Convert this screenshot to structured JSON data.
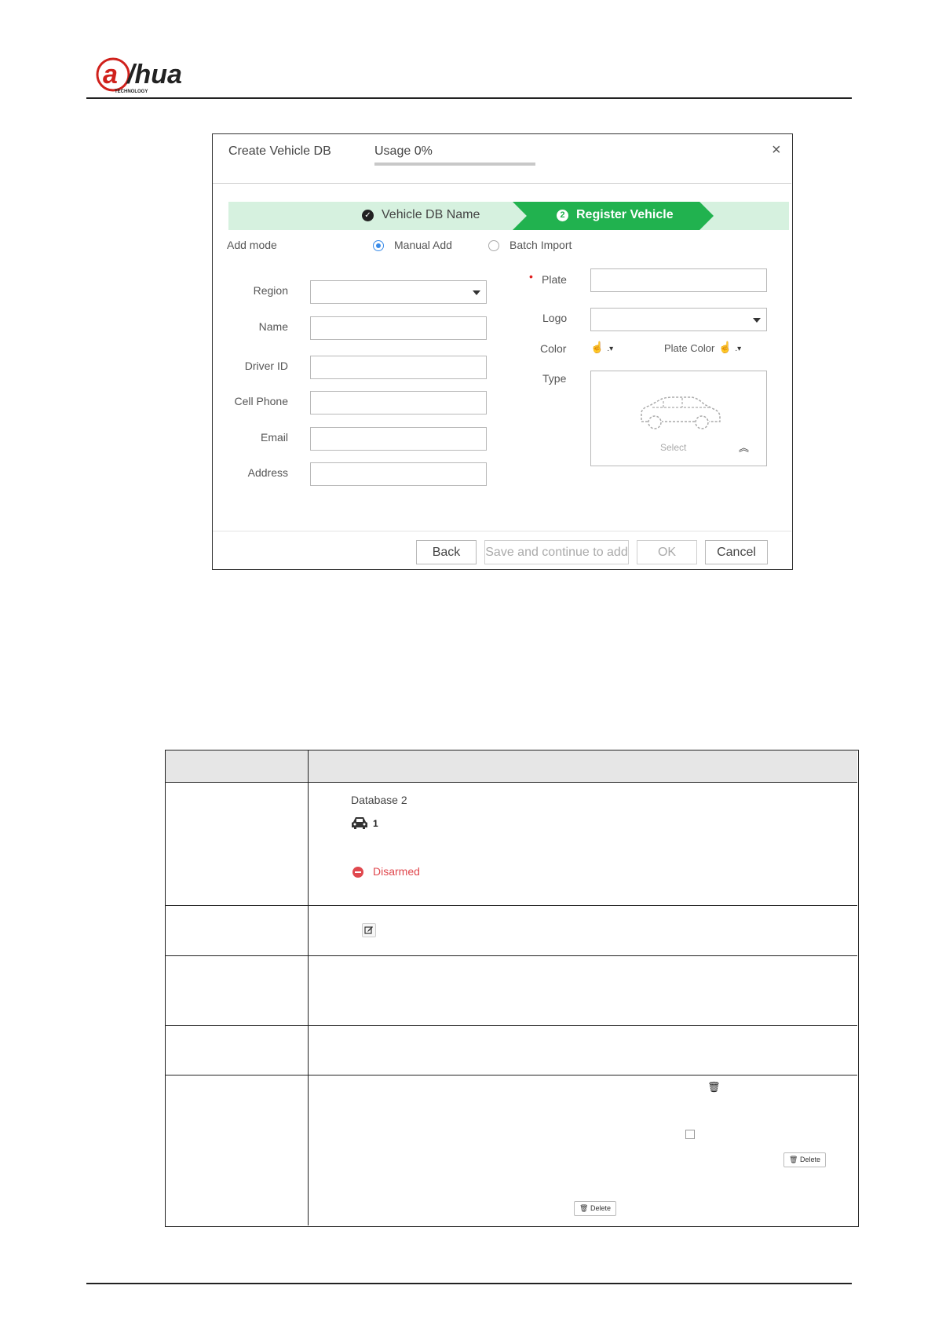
{
  "brand": {
    "logo_text": "alhua",
    "logo_sub": "TECHNOLOGY"
  },
  "dialog": {
    "title": "Create Vehicle DB",
    "usage_label": "Usage 0%",
    "usage_percent": 0,
    "close_glyph": "×",
    "steps": [
      {
        "label": "Vehicle DB Name",
        "state": "done",
        "icon": "check-circle-icon"
      },
      {
        "label": "Register Vehicle",
        "state": "active",
        "number": "2"
      }
    ],
    "add_mode": {
      "label": "Add mode",
      "options": [
        {
          "label": "Manual Add",
          "selected": true
        },
        {
          "label": "Batch Import",
          "selected": false
        }
      ]
    },
    "left_fields": [
      {
        "label": "Region",
        "type": "select",
        "value": ""
      },
      {
        "label": "Name",
        "type": "text",
        "value": ""
      },
      {
        "label": "Driver ID",
        "type": "text",
        "value": ""
      },
      {
        "label": "Cell Phone",
        "type": "text",
        "value": ""
      },
      {
        "label": "Email",
        "type": "text",
        "value": ""
      },
      {
        "label": "Address",
        "type": "text",
        "value": ""
      }
    ],
    "right_fields": {
      "plate_label": "Plate",
      "required_mark": "•",
      "logo_label": "Logo",
      "color_label": "Color",
      "plate_color_label": "Plate Color",
      "type_label": "Type",
      "type_placeholder": "Select",
      "picker_glyph": "☝",
      "chevron_up": "︽"
    },
    "buttons": {
      "back": "Back",
      "save_continue": "Save and continue to add",
      "ok": "OK",
      "cancel": "Cancel"
    }
  },
  "table": {
    "db_name": "Database 2",
    "vehicle_count": "1",
    "status": "Disarmed",
    "status_color": "#e0484e",
    "delete_label": "Delete",
    "trash_glyph": "🗑"
  }
}
